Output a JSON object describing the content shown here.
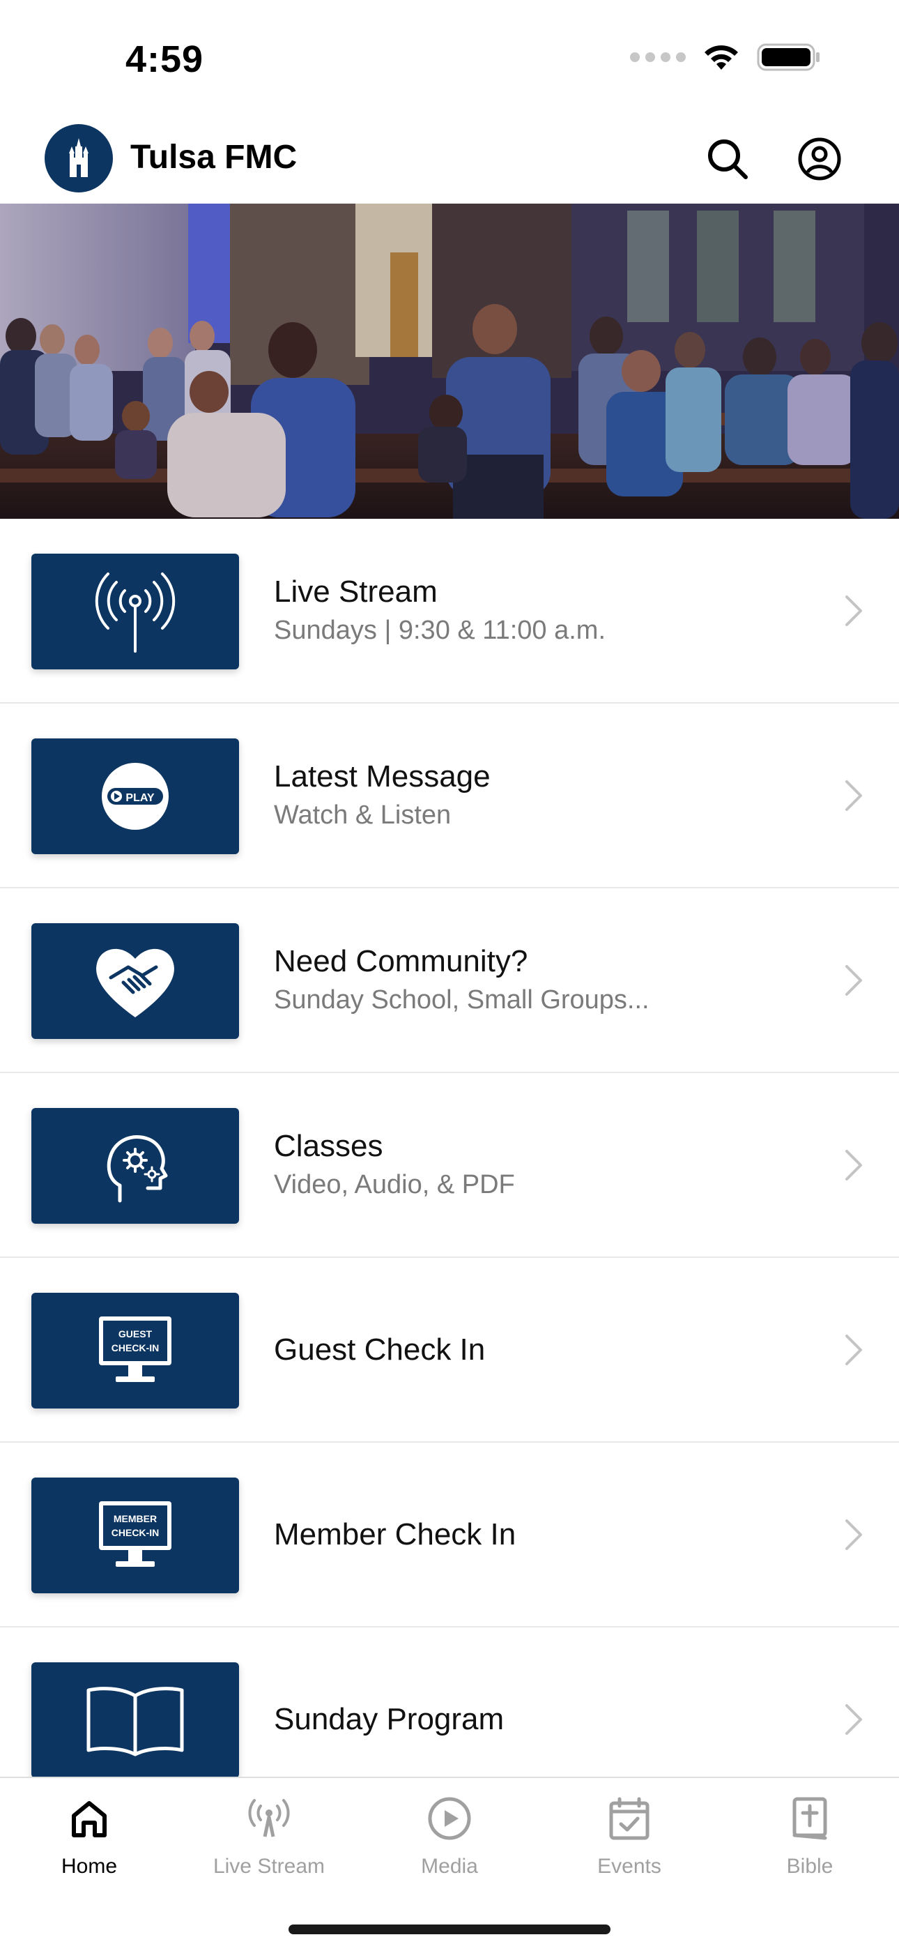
{
  "status_bar": {
    "time": "4:59"
  },
  "header": {
    "title": "Tulsa FMC",
    "logo_icon": "church-logo-icon",
    "search_icon": "search-icon",
    "profile_icon": "account-circle-icon"
  },
  "colors": {
    "brand_navy": "#0d3561",
    "subtitle_gray": "#7a7a7a",
    "tab_inactive": "#a0a0a0"
  },
  "list": {
    "items": [
      {
        "title": "Live Stream",
        "subtitle": "Sundays | 9:30 & 11:00 a.m.",
        "icon": "broadcast-antenna-icon"
      },
      {
        "title": "Latest Message",
        "subtitle": "Watch & Listen",
        "icon": "play-badge-icon",
        "badge_text": "PLAY"
      },
      {
        "title": "Need Community?",
        "subtitle": "Sunday School, Small Groups...",
        "icon": "heart-handshake-icon"
      },
      {
        "title": "Classes",
        "subtitle": "Video, Audio, & PDF",
        "icon": "head-gears-icon"
      },
      {
        "title": "Guest Check In",
        "subtitle": "",
        "icon": "monitor-icon",
        "monitor_text": [
          "GUEST",
          "CHECK-IN"
        ]
      },
      {
        "title": "Member Check In",
        "subtitle": "",
        "icon": "monitor-icon",
        "monitor_text": [
          "MEMBER",
          "CHECK-IN"
        ]
      },
      {
        "title": "Sunday Program",
        "subtitle": "",
        "icon": "open-book-icon"
      }
    ]
  },
  "tabs": [
    {
      "label": "Home",
      "icon": "home-icon",
      "active": true
    },
    {
      "label": "Live Stream",
      "icon": "antenna-icon",
      "active": false
    },
    {
      "label": "Media",
      "icon": "play-circle-icon",
      "active": false
    },
    {
      "label": "Events",
      "icon": "calendar-check-icon",
      "active": false
    },
    {
      "label": "Bible",
      "icon": "bible-icon",
      "active": false
    }
  ]
}
